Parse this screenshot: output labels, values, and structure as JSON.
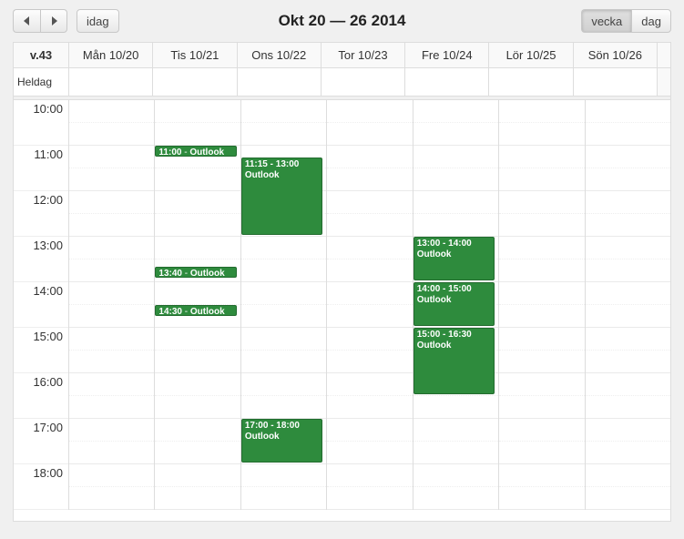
{
  "toolbar": {
    "prev_label": "◀",
    "next_label": "▶",
    "today_label": "idag",
    "title": "Okt 20 — 26 2014",
    "week_label": "vecka",
    "day_label": "dag"
  },
  "axis": {
    "week_label": "v.43",
    "allday_label": "Heldag"
  },
  "days": [
    {
      "label": "Mån 10/20"
    },
    {
      "label": "Tis 10/21"
    },
    {
      "label": "Ons 10/22"
    },
    {
      "label": "Tor 10/23"
    },
    {
      "label": "Fre 10/24"
    },
    {
      "label": "Lör 10/25"
    },
    {
      "label": "Sön 10/26"
    }
  ],
  "hours": [
    "10:00",
    "11:00",
    "12:00",
    "13:00",
    "14:00",
    "15:00",
    "16:00",
    "17:00",
    "18:00"
  ],
  "events": [
    {
      "day": 1,
      "start": "11:00",
      "end": "11:15",
      "time_label": "11:00",
      "title": "Outlook",
      "compact": true
    },
    {
      "day": 1,
      "start": "13:40",
      "end": "13:55",
      "time_label": "13:40",
      "title": "Outlook",
      "compact": true
    },
    {
      "day": 1,
      "start": "14:30",
      "end": "14:45",
      "time_label": "14:30",
      "title": "Outlook",
      "compact": true
    },
    {
      "day": 2,
      "start": "11:15",
      "end": "13:00",
      "time_label": "11:15 - 13:00",
      "title": "Outlook",
      "compact": false
    },
    {
      "day": 2,
      "start": "17:00",
      "end": "18:00",
      "time_label": "17:00 - 18:00",
      "title": "Outlook",
      "compact": false
    },
    {
      "day": 4,
      "start": "13:00",
      "end": "14:00",
      "time_label": "13:00 - 14:00",
      "title": "Outlook",
      "compact": false
    },
    {
      "day": 4,
      "start": "14:00",
      "end": "15:00",
      "time_label": "14:00 - 15:00",
      "title": "Outlook",
      "compact": false
    },
    {
      "day": 4,
      "start": "15:00",
      "end": "16:30",
      "time_label": "15:00 - 16:30",
      "title": "Outlook",
      "compact": false
    }
  ],
  "colors": {
    "event_bg": "#2e8b3d",
    "event_border": "#236b2f"
  }
}
